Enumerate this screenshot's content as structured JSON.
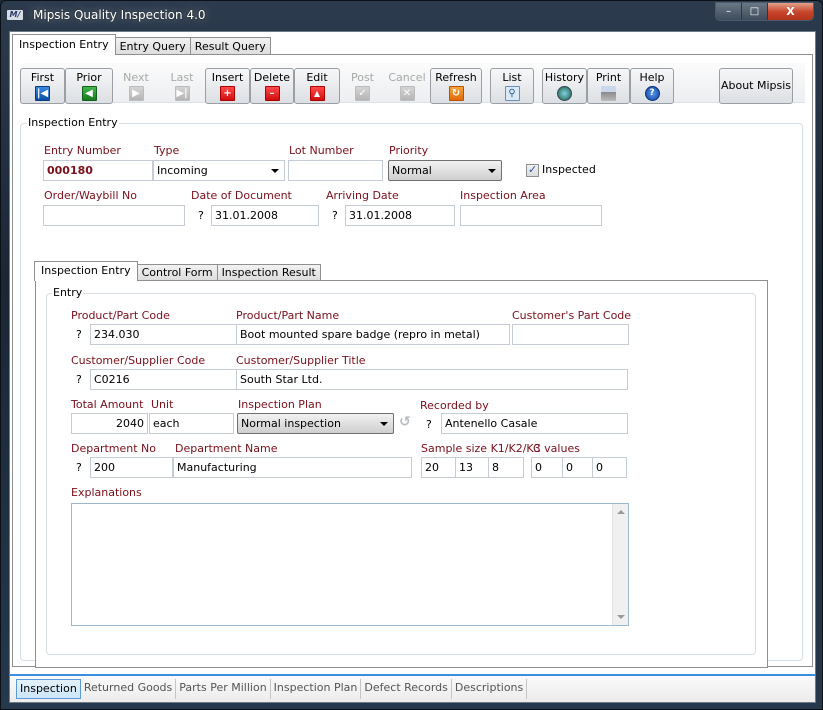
{
  "window": {
    "title": "Mipsis Quality Inspection 4.0",
    "logo_text": "M/",
    "caption_buttons": {
      "minimize": "–",
      "maximize": "□",
      "close": "X"
    }
  },
  "top_tabs": [
    {
      "label": "Inspection Entry",
      "active": true
    },
    {
      "label": "Entry Query",
      "active": false
    },
    {
      "label": "Result Query",
      "active": false
    }
  ],
  "toolbar": {
    "first": "First",
    "prior": "Prior",
    "next": "Next",
    "last": "Last",
    "insert": "Insert",
    "delete": "Delete",
    "edit": "Edit",
    "post": "Post",
    "cancel": "Cancel",
    "refresh": "Refresh",
    "list": "List",
    "history": "History",
    "print": "Print",
    "help": "Help",
    "about": "About Mipsis"
  },
  "header_group": {
    "title": "Inspection Entry",
    "entry_number": {
      "label": "Entry Number",
      "value": "000180"
    },
    "type": {
      "label": "Type",
      "value": "Incoming"
    },
    "lot_number": {
      "label": "Lot Number",
      "value": ""
    },
    "priority": {
      "label": "Priority",
      "value": "Normal"
    },
    "inspected": {
      "label": "Inspected",
      "checked": true
    },
    "order_waybill": {
      "label": "Order/Waybill No",
      "value": ""
    },
    "date_of_document": {
      "label": "Date of Document",
      "value": "31.01.2008"
    },
    "arriving_date": {
      "label": "Arriving Date",
      "value": "31.01.2008"
    },
    "inspection_area": {
      "label": "Inspection Area",
      "value": ""
    },
    "lookup_mark": "?"
  },
  "inner_tabs": [
    {
      "label": "Inspection Entry",
      "active": true
    },
    {
      "label": "Control Form",
      "active": false
    },
    {
      "label": "Inspection Result",
      "active": false
    }
  ],
  "entry_group": {
    "title": "Entry",
    "product_code": {
      "label": "Product/Part Code",
      "value": "234.030"
    },
    "product_name": {
      "label": "Product/Part Name",
      "value": "Boot mounted spare badge (repro in metal)"
    },
    "customer_part_code": {
      "label": "Customer's Part Code",
      "value": ""
    },
    "supplier_code": {
      "label": "Customer/Supplier Code",
      "value": "C0216"
    },
    "supplier_title": {
      "label": "Customer/Supplier Title",
      "value": "South Star Ltd."
    },
    "total_amount": {
      "label": "Total Amount",
      "value": "2040"
    },
    "unit": {
      "label": "Unit",
      "value": "each"
    },
    "inspection_plan": {
      "label": "Inspection Plan",
      "value": "Normal inspection"
    },
    "recorded_by": {
      "label": "Recorded by",
      "value": "Antenello Casale"
    },
    "department_no": {
      "label": "Department No",
      "value": "200"
    },
    "department_name": {
      "label": "Department Name",
      "value": "Manufacturing"
    },
    "sample_size": {
      "label": "Sample size K1/K2/K3",
      "values": [
        "20",
        "13",
        "8"
      ]
    },
    "c_values": {
      "label": "C  values",
      "values": [
        "0",
        "0",
        "0"
      ]
    },
    "explanations": {
      "label": "Explanations",
      "value": ""
    },
    "lookup_mark": "?"
  },
  "bottom_tabs": [
    {
      "label": "Inspection",
      "active": true
    },
    {
      "label": "Returned Goods",
      "active": false
    },
    {
      "label": "Parts Per Million",
      "active": false
    },
    {
      "label": "Inspection Plan",
      "active": false
    },
    {
      "label": "Defect Records",
      "active": false
    },
    {
      "label": "Descriptions",
      "active": false
    }
  ]
}
